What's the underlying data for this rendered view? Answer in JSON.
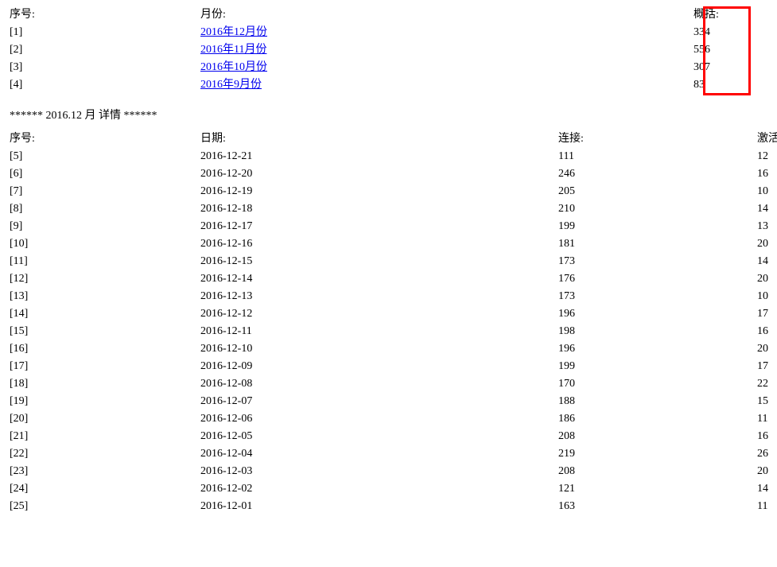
{
  "headers": {
    "seq": "序号:",
    "month": "月份:",
    "summary": "概括:",
    "date": "日期:",
    "conn": "连接:",
    "act": "激活:"
  },
  "months": [
    {
      "seq": "[1]",
      "label": "2016年12月份",
      "summary": "334"
    },
    {
      "seq": "[2]",
      "label": "2016年11月份",
      "summary": "556"
    },
    {
      "seq": "[3]",
      "label": "2016年10月份",
      "summary": "307"
    },
    {
      "seq": "[4]",
      "label": "2016年9月份",
      "summary": "83"
    }
  ],
  "divider": "****** 2016.12 月 详情 ******",
  "details": [
    {
      "seq": "[5]",
      "date": "2016-12-21",
      "conn": "111",
      "act": "12"
    },
    {
      "seq": "[6]",
      "date": "2016-12-20",
      "conn": "246",
      "act": "16"
    },
    {
      "seq": "[7]",
      "date": "2016-12-19",
      "conn": "205",
      "act": "10"
    },
    {
      "seq": "[8]",
      "date": "2016-12-18",
      "conn": "210",
      "act": "14"
    },
    {
      "seq": "[9]",
      "date": "2016-12-17",
      "conn": "199",
      "act": "13"
    },
    {
      "seq": "[10]",
      "date": "2016-12-16",
      "conn": "181",
      "act": "20"
    },
    {
      "seq": "[11]",
      "date": "2016-12-15",
      "conn": "173",
      "act": "14"
    },
    {
      "seq": "[12]",
      "date": "2016-12-14",
      "conn": "176",
      "act": "20"
    },
    {
      "seq": "[13]",
      "date": "2016-12-13",
      "conn": "173",
      "act": "10"
    },
    {
      "seq": "[14]",
      "date": "2016-12-12",
      "conn": "196",
      "act": "17"
    },
    {
      "seq": "[15]",
      "date": "2016-12-11",
      "conn": "198",
      "act": "16"
    },
    {
      "seq": "[16]",
      "date": "2016-12-10",
      "conn": "196",
      "act": "20"
    },
    {
      "seq": "[17]",
      "date": "2016-12-09",
      "conn": "199",
      "act": "17"
    },
    {
      "seq": "[18]",
      "date": "2016-12-08",
      "conn": "170",
      "act": "22"
    },
    {
      "seq": "[19]",
      "date": "2016-12-07",
      "conn": "188",
      "act": "15"
    },
    {
      "seq": "[20]",
      "date": "2016-12-06",
      "conn": "186",
      "act": "11"
    },
    {
      "seq": "[21]",
      "date": "2016-12-05",
      "conn": "208",
      "act": "16"
    },
    {
      "seq": "[22]",
      "date": "2016-12-04",
      "conn": "219",
      "act": "26"
    },
    {
      "seq": "[23]",
      "date": "2016-12-03",
      "conn": "208",
      "act": "20"
    },
    {
      "seq": "[24]",
      "date": "2016-12-02",
      "conn": "121",
      "act": "14"
    },
    {
      "seq": "[25]",
      "date": "2016-12-01",
      "conn": "163",
      "act": "11"
    }
  ]
}
